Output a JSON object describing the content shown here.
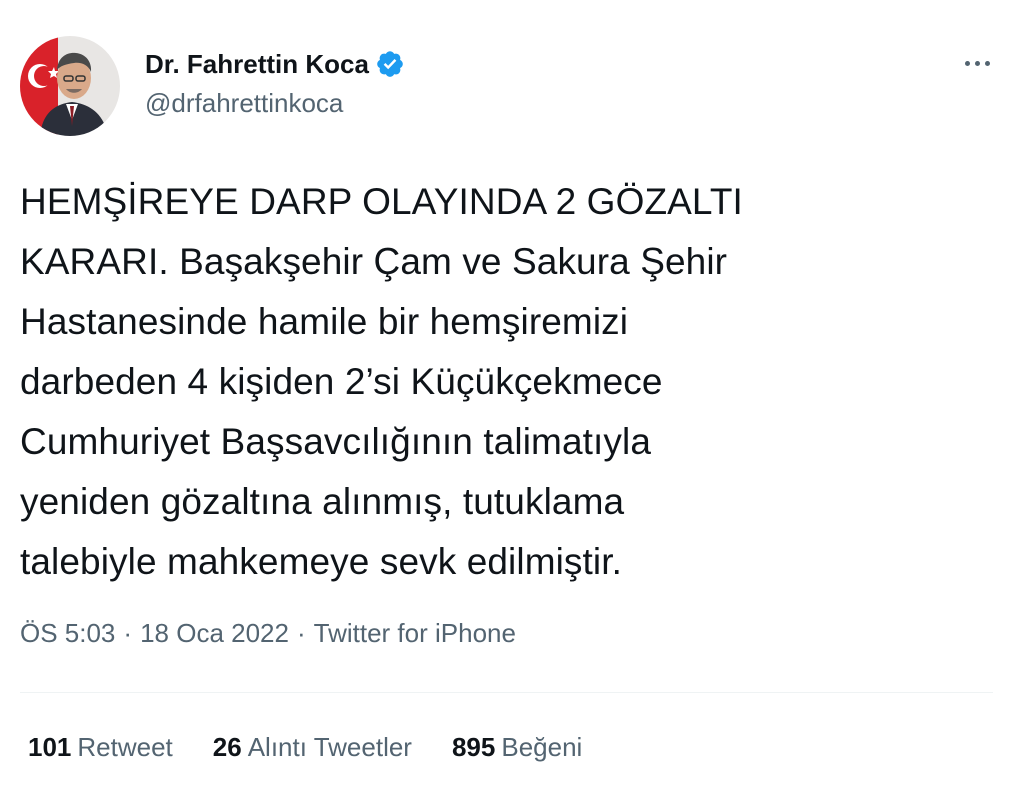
{
  "author": {
    "display_name": "Dr. Fahrettin Koca",
    "handle": "@drfahrettinkoca",
    "verified": true,
    "verified_icon": "verified-badge-icon",
    "verified_color": "#1d9bf0"
  },
  "tweet": {
    "text": "HEMŞİREYE DARP OLAYINDA 2 GÖZALTI\nKARARI. Başakşehir Çam ve Sakura Şehir\nHastanesinde hamile bir hemşiremizi\ndarbeden 4 kişiden 2’si Küçükçekmece\nCumhuriyet Başsavcılığının talimatıyla\nyeniden gözaltına alınmış, tutuklama\ntalebiyle mahkemeye sevk edilmiştir."
  },
  "meta": {
    "time": "ÖS 5:03",
    "date": "18 Oca 2022",
    "source": "Twitter for iPhone",
    "separator": "·"
  },
  "stats": {
    "retweets_count": "101",
    "retweets_label": "Retweet",
    "quotes_count": "26",
    "quotes_label": "Alıntı Tweetler",
    "likes_count": "895",
    "likes_label": "Beğeni"
  },
  "colors": {
    "text_primary": "#0f1419",
    "text_secondary": "#536471",
    "accent": "#1d9bf0",
    "divider": "#eff3f4"
  }
}
